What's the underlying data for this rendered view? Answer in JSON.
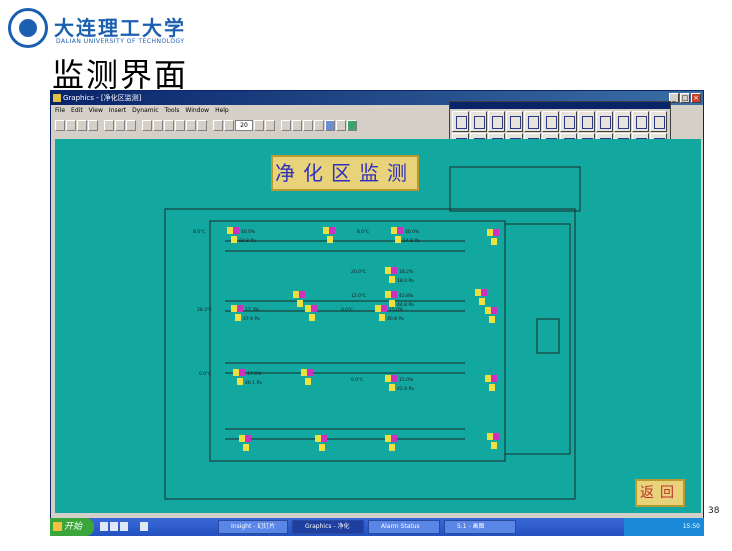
{
  "slide": {
    "university_cn": "大连理工大学",
    "university_en": "DALIAN UNIVERSITY OF TECHNOLOGY",
    "title": "监测界面",
    "page_number": "38"
  },
  "window": {
    "title": "Graphics - [净化区监测]",
    "menus": [
      "File",
      "Edit",
      "View",
      "Insert",
      "Dynamic",
      "Tools",
      "Window",
      "Help"
    ],
    "zoom": "20"
  },
  "canvas": {
    "background": "#12a8a0",
    "header_label": "净化区监测",
    "return_label": "返回"
  },
  "sensors": [
    {
      "row": 1,
      "temp": "8.0℃",
      "rh": "40.0%",
      "p": "60.8 Pa"
    },
    {
      "row": 1,
      "temp": "8.0℃",
      "rh": "40.0%",
      "p": "54.8 Pa"
    },
    {
      "row": 1,
      "temp": "20.0℃",
      "rh": "18.2%",
      "p": "18.0 Pa"
    },
    {
      "row": 1,
      "temp": "12.0℃",
      "rh": "43.8%",
      "p": "44.8 Pa"
    },
    {
      "row": 2,
      "temp": "28.3℃",
      "rh": "17.3%",
      "p": "47.9 Pa"
    },
    {
      "row": 3,
      "temp": "0.0℃",
      "rh": "15.0%",
      "p": "40.8 Pa"
    },
    {
      "row": 4,
      "temp": "0.0℃",
      "rh": "17.6%",
      "p": "46.1 Pa"
    },
    {
      "row": 5,
      "temp": "0.0℃",
      "rh": "15.0%",
      "p": "42.9 Pa"
    }
  ],
  "taskbar": {
    "start_label": "开始",
    "tasks": [
      "Insight - 幻灯片",
      "Graphics - 净化",
      "Alarm Status",
      "5.1 - 画图"
    ],
    "clock": "15:50"
  }
}
